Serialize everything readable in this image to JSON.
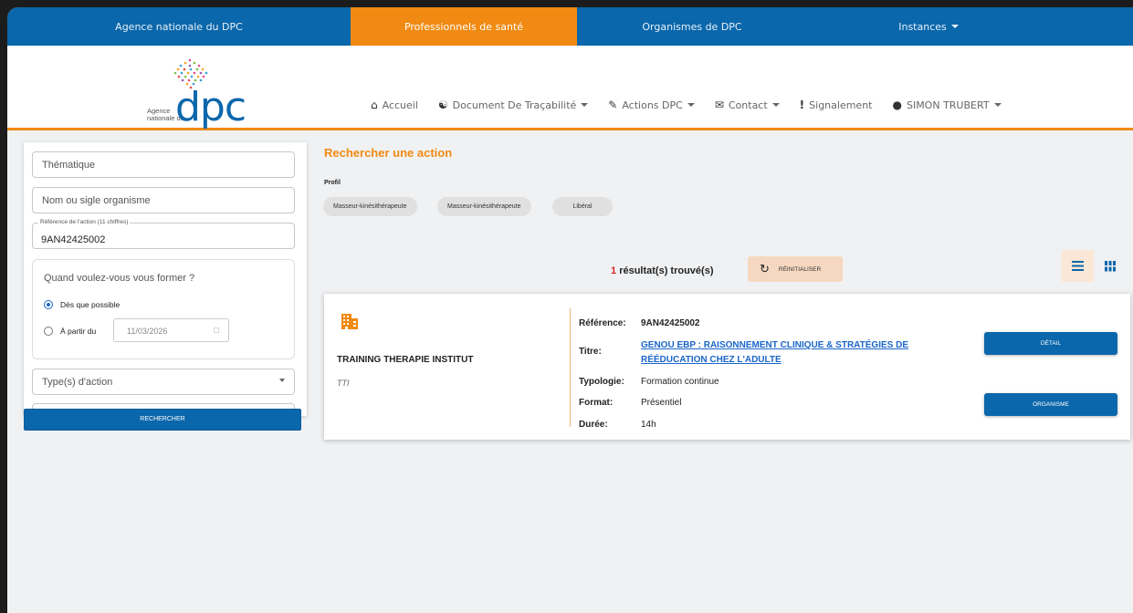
{
  "topbar": {
    "tabs": [
      {
        "label": "Agence nationale du DPC"
      },
      {
        "label": "Professionnels de santé"
      },
      {
        "label": "Organismes de DPC"
      },
      {
        "label": "Instances"
      }
    ]
  },
  "logo": {
    "line1": "Agence",
    "line2": "nationale du",
    "brand": "dpc"
  },
  "nav": {
    "accueil": "Accueil",
    "document": "Document De Traçabilité",
    "actions": "Actions DPC",
    "contact": "Contact",
    "signalement": "Signalement",
    "user": "SIMON TRUBERT"
  },
  "filters": {
    "thematique_placeholder": "Thématique",
    "organisme_placeholder": "Nom ou sigle organisme",
    "reference_label": "Référence de l'action (11 chiffres)",
    "reference_value": "9AN42425002",
    "when_title": "Quand voulez-vous vous former ?",
    "asap_label": "Dès que possible",
    "from_label": "À partir du",
    "from_date": "11/03/2026",
    "type_placeholder": "Type(s) d'action",
    "search_button": "RECHERCHER"
  },
  "main": {
    "title": "Rechercher une action",
    "profil_label": "Profil",
    "chips": [
      "Masseur-kinésithérapeute",
      "Masseur-kinésithérapeute",
      "Libéral"
    ],
    "results_count": "1",
    "results_text": "résultat(s) trouvé(s)",
    "reset_button": "RÉINITIALISER"
  },
  "result": {
    "org_name": "TRAINING THERAPIE INSTITUT",
    "org_sigle": "TTI",
    "labels": {
      "reference": "Référence:",
      "titre": "Titre:",
      "typologie": "Typologie:",
      "format": "Format:",
      "duree": "Durée:"
    },
    "reference": "9AN42425002",
    "titre_line1": "GENOU EBP : RAISONNEMENT CLINIQUE & STRATÉGIES DE",
    "titre_line2": "RÉÉDUCATION CHEZ L'ADULTE",
    "typologie": "Formation continue",
    "format": "Présentiel",
    "duree": "14h",
    "detail_button": "DÉTAIL",
    "organisme_button": "ORGANISME"
  },
  "colors": {
    "primary_blue": "#0b67ab",
    "accent_orange": "#f08a12",
    "link_blue": "#1a66c9",
    "count_red": "#d8241e"
  }
}
